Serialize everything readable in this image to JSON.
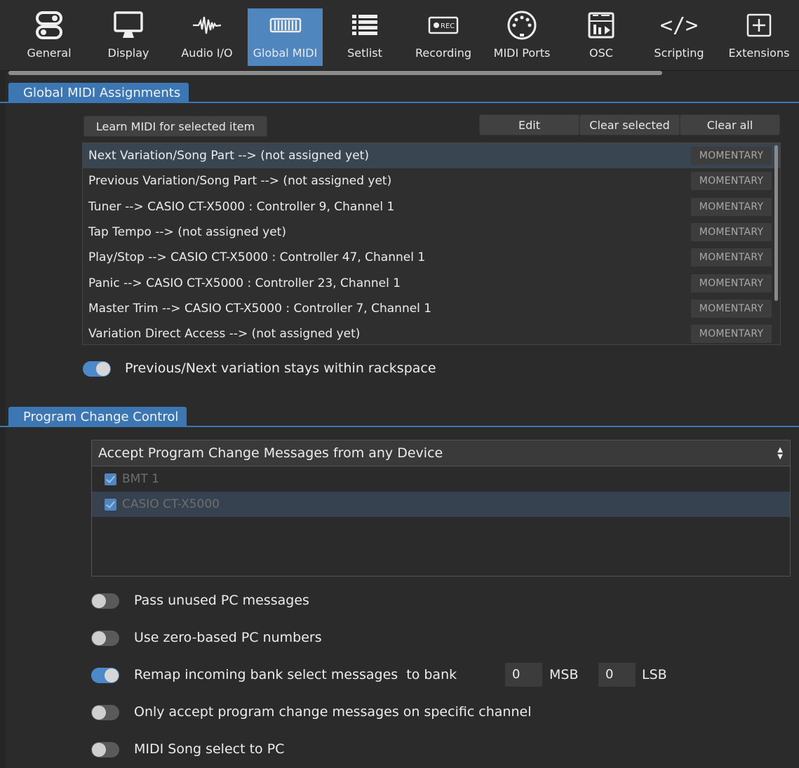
{
  "toolbar": {
    "tabs": [
      {
        "label": "General",
        "icon": "toggles-icon"
      },
      {
        "label": "Display",
        "icon": "monitor-icon"
      },
      {
        "label": "Audio I/O",
        "icon": "waveform-icon"
      },
      {
        "label": "Global MIDI",
        "icon": "keyboard-icon",
        "active": true
      },
      {
        "label": "Setlist",
        "icon": "list-icon"
      },
      {
        "label": "Recording",
        "icon": "rec-icon",
        "icon_text": "REC"
      },
      {
        "label": "MIDI Ports",
        "icon": "midi-din-icon"
      },
      {
        "label": "OSC",
        "icon": "osc-icon"
      },
      {
        "label": "Scripting",
        "icon": "code-icon",
        "icon_text": "</>"
      },
      {
        "label": "Extensions",
        "icon": "plus-box-icon",
        "icon_text": "+"
      }
    ]
  },
  "global_midi": {
    "header": "Global MIDI Assignments",
    "learn_button": "Learn MIDI for selected item",
    "edit_button": "Edit",
    "clear_selected_button": "Clear selected",
    "clear_all_button": "Clear all",
    "assignments": [
      {
        "text": "Next Variation/Song Part --> (not assigned yet)",
        "mode": "MOMENTARY",
        "selected": true
      },
      {
        "text": "Previous Variation/Song Part --> (not assigned yet)",
        "mode": "MOMENTARY"
      },
      {
        "text": "Tuner --> CASIO CT-X5000 : Controller 9, Channel 1",
        "mode": "MOMENTARY"
      },
      {
        "text": "Tap Tempo --> (not assigned yet)",
        "mode": "MOMENTARY"
      },
      {
        "text": "Play/Stop --> CASIO CT-X5000 : Controller 47, Channel 1",
        "mode": "MOMENTARY"
      },
      {
        "text": "Panic --> CASIO CT-X5000 : Controller 23, Channel 1",
        "mode": "MOMENTARY"
      },
      {
        "text": "Master Trim --> CASIO CT-X5000 : Controller 7, Channel 1",
        "mode": "MOMENTARY"
      },
      {
        "text": "Variation Direct Access --> (not assigned yet)",
        "mode": "MOMENTARY"
      }
    ],
    "stay_within_rackspace": {
      "label": "Previous/Next variation stays within rackspace",
      "on": true
    }
  },
  "program_change": {
    "header": "Program Change Control",
    "source_select": "Accept Program Change Messages from any Device",
    "devices": [
      {
        "name": "BMT 1",
        "checked": true
      },
      {
        "name": "CASIO CT-X5000",
        "checked": true,
        "selected": true
      }
    ],
    "options": {
      "pass_unused": {
        "label": "Pass unused PC messages",
        "on": false
      },
      "zero_based": {
        "label": "Use zero-based PC numbers",
        "on": false
      },
      "remap_bank": {
        "label": "Remap incoming bank select messages  to bank",
        "on": true,
        "msb_value": "0",
        "msb_label": "MSB",
        "lsb_value": "0",
        "lsb_label": "LSB"
      },
      "specific_channel": {
        "label": "Only accept program change messages on specific channel",
        "on": false
      },
      "song_select": {
        "label": "MIDI Song select to PC",
        "on": false
      }
    }
  },
  "colors": {
    "accent": "#3d77b3",
    "toggle_on": "#4d88c9",
    "background": "#2b2b2b"
  }
}
